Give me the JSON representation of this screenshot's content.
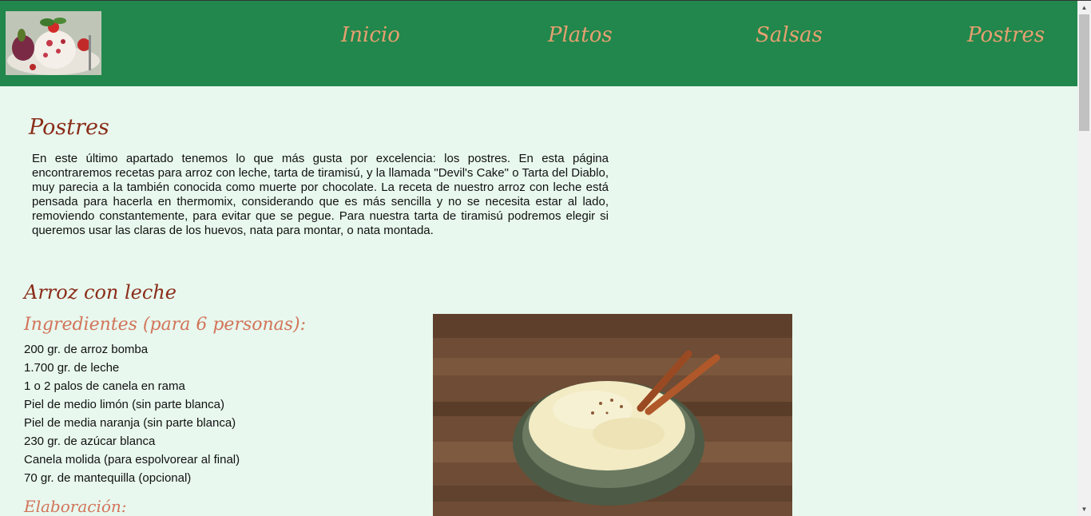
{
  "header": {
    "logo_alt": "dessert-photo",
    "nav": [
      "Inicio",
      "Platos",
      "Salsas",
      "Postres"
    ]
  },
  "section": {
    "title": "Postres",
    "intro": "En este último apartado tenemos lo que más gusta por excelencia: los postres. En esta página encontraremos recetas para arroz con leche, tarta de tiramisú, y la llamada \"Devil's Cake\" o Tarta del Diablo, muy parecia a la también conocida como muerte por chocolate. La receta de nuestro arroz con leche está pensada para hacerla en thermomix, considerando que es más sencilla y no se necesita estar al lado, removiendo constantemente, para evitar que se pegue. Para nuestra tarta de tiramisú podremos elegir si queremos usar las claras de los huevos, nata para montar, o nata montada."
  },
  "recipe": {
    "title": "Arroz con leche",
    "ingredients_title": "Ingredientes (para 6 personas):",
    "ingredients": [
      "200 gr. de arroz bomba",
      "1.700 gr. de leche",
      "1 o 2 palos de canela en rama",
      "Piel de medio limón (sin parte blanca)",
      "Piel de media naranja (sin parte blanca)",
      "230 gr. de azúcar blanca",
      "Canela molida (para espolvorear al final)",
      "70 gr. de mantequilla (opcional)"
    ],
    "elaboration_title": "Elaboración:"
  },
  "colors": {
    "header_bg": "#21874c",
    "page_bg": "#e8f8ee",
    "nav_text": "#e6a070",
    "heading": "#8b2d1a",
    "subheading": "#d2745a"
  }
}
